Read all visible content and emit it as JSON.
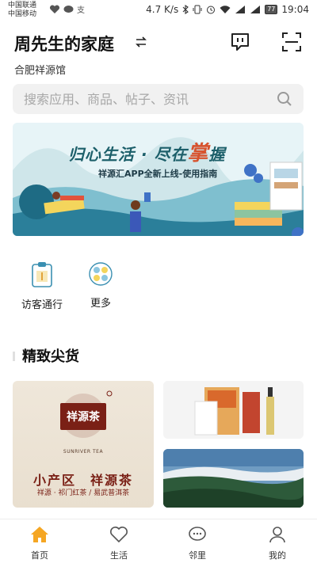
{
  "status_bar": {
    "carrier_1": "中国联通",
    "carrier_2": "中国移动",
    "speed": "4.7 K/s",
    "battery": "77",
    "time": "19:04"
  },
  "header": {
    "title": "周先生的家庭",
    "subtitle": "合肥祥源馆"
  },
  "search": {
    "placeholder": "搜索应用、商品、帖子、资讯"
  },
  "banner": {
    "title_part1": "归心生活 · 尽在",
    "title_accent": "掌",
    "title_part2": "握",
    "subtitle": "祥源汇APP全新上线-使用指南"
  },
  "quick_actions": {
    "visitor": "访客通行",
    "more": "更多"
  },
  "section": {
    "title": "精致尖货"
  },
  "product_card": {
    "brand_cn": "祥源茶",
    "brand_en": "SUNRIVER TEA",
    "line1": "小产区　祥源茶",
    "line2": "祥源 · 祁门红茶 / 易武普洱茶"
  },
  "bottom_nav": {
    "home": "首页",
    "life": "生活",
    "neighbor": "邻里",
    "me": "我的"
  },
  "colors": {
    "accent": "#f5a623",
    "banner_bg": "#e7f4f7",
    "brand_red": "#7a2016"
  }
}
